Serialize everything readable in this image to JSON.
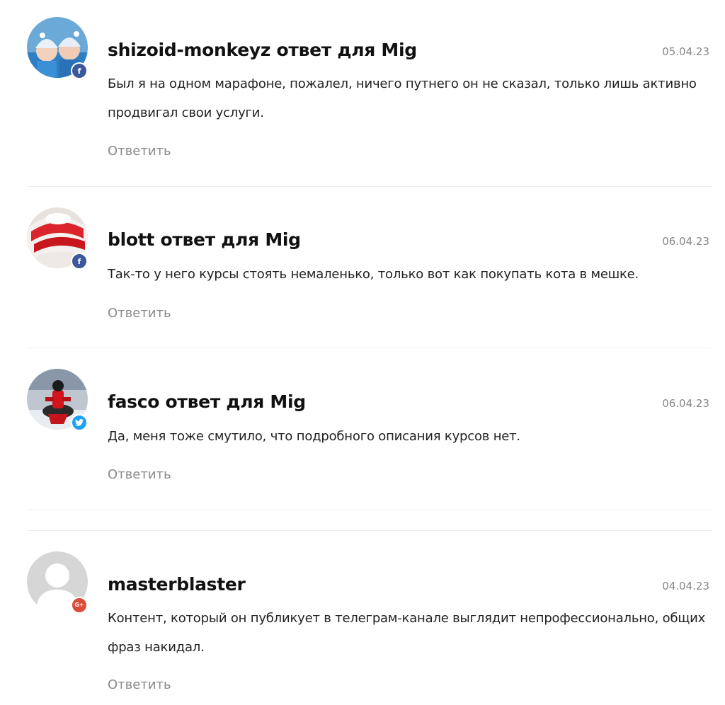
{
  "comments": [
    {
      "author": "shizoid-monkeyz ответ для Mig",
      "date": "05.04.23",
      "text": "Был я на одном марафоне, пожалел, ничего путнего он не сказал, только лишь активно продвигал свои услуги.",
      "reply_label": "Ответить",
      "social": "facebook",
      "badge_glyph": "f"
    },
    {
      "author": "blott ответ для Mig",
      "date": "06.04.23",
      "text": "Так-то у него курсы стоять немаленько, только вот как покупать кота в мешке.",
      "reply_label": "Ответить",
      "social": "facebook",
      "badge_glyph": "f"
    },
    {
      "author": "fasco ответ для Mig",
      "date": "06.04.23",
      "text": "Да, меня тоже смутило, что подробного описания курсов нет.",
      "reply_label": "Ответить",
      "social": "twitter",
      "badge_glyph": ""
    },
    {
      "author": "masterblaster",
      "date": "04.04.23",
      "text": "Контент, который он публикует в телеграм-канале выглядит непрофессионально, общих фраз накидал.",
      "reply_label": "Ответить",
      "social": "google",
      "badge_glyph": "G+"
    }
  ],
  "colors": {
    "facebook": "#3b5998",
    "twitter": "#1da1f2",
    "google": "#dd4b39",
    "reply": "#8a8a8a",
    "date": "#888888"
  }
}
